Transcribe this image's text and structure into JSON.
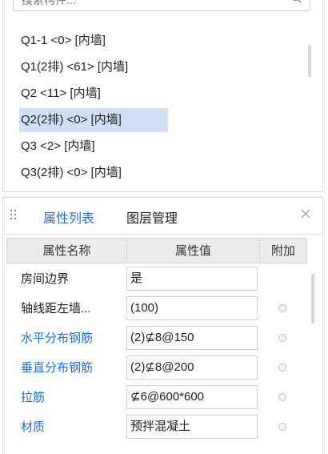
{
  "search": {
    "placeholder": "搜索构件..."
  },
  "components": [
    {
      "label": "Q1-1 <0> [内墙]",
      "selected": false
    },
    {
      "label": "Q1(2排) <61> [内墙]",
      "selected": false
    },
    {
      "label": "Q2 <11> [内墙]",
      "selected": false
    },
    {
      "label": "Q2(2排) <0> [内墙]",
      "selected": true
    },
    {
      "label": "Q3 <2> [内墙]",
      "selected": false
    },
    {
      "label": "Q3(2排) <0> [内墙]",
      "selected": false
    }
  ],
  "tabs": {
    "properties": "属性列表",
    "layers": "图层管理"
  },
  "grid": {
    "headers": {
      "name": "属性名称",
      "value": "属性值",
      "extra": "附加"
    },
    "rows": [
      {
        "name": "房间边界",
        "value": "是"
      },
      {
        "name": "轴线距左墙...",
        "value": "(100)"
      },
      {
        "name": "水平分布钢筋",
        "value": "(2)⊈8@150"
      },
      {
        "name": "垂直分布钢筋",
        "value": "(2)⊈8@200"
      },
      {
        "name": "拉筋",
        "value": "⊈6@600*600"
      },
      {
        "name": "材质",
        "value": "预拌混凝土"
      }
    ]
  },
  "colors": {
    "accent": "#1e6fd9",
    "selection": "#cfe0f5"
  }
}
